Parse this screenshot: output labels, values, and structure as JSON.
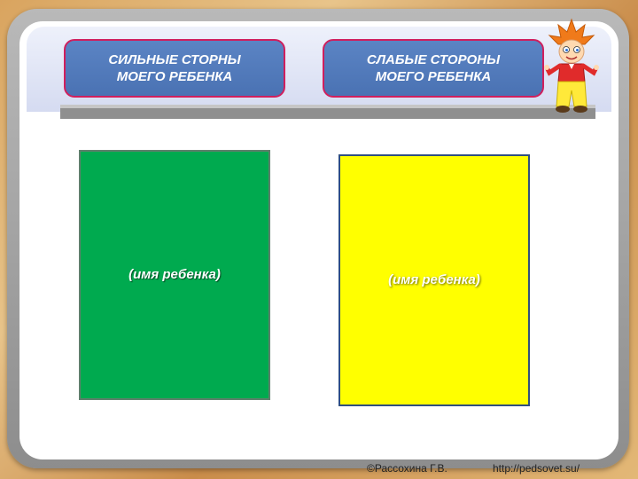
{
  "header": {
    "left_title": [
      "СИЛЬНЫЕ СТОРНЫ",
      "МОЕГО РЕБЕНКА"
    ],
    "right_title": [
      "СЛАБЫЕ СТОРОНЫ",
      "МОЕГО РЕБЕНКА"
    ]
  },
  "cards": {
    "strong_label": "(имя ребенка)",
    "weak_label": "(имя ребенка)"
  },
  "footer": {
    "author": "©Рассохина Г.В.",
    "url": "http://pedsovet.su/"
  },
  "icons": {
    "mascot": "cartoon-boy-mascot-icon"
  },
  "colors": {
    "header_button": "#4f78b9",
    "header_border": "#d01f5d",
    "strong_card": "#00aa4f",
    "weak_card": "#ffff00"
  }
}
